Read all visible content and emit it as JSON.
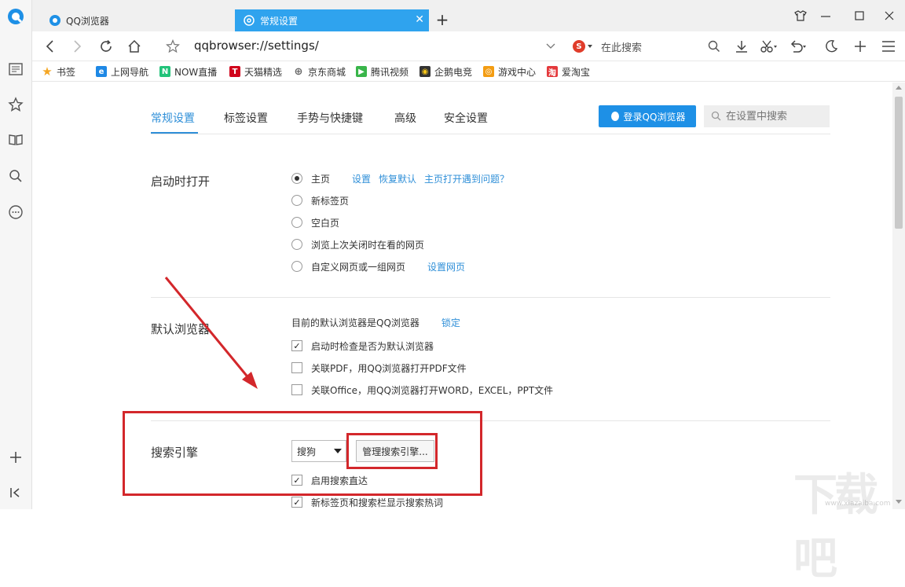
{
  "tabs": [
    {
      "label": "QQ浏览器",
      "active": false
    },
    {
      "label": "常规设置",
      "active": true
    }
  ],
  "address": {
    "url": "qqbrowser://settings/",
    "search_placeholder": "在此搜索",
    "search_engine_badge": "S"
  },
  "bookmarks": [
    {
      "label": "书签",
      "icon": "star-icon"
    },
    {
      "label": "上网导航",
      "icon": "ie-icon"
    },
    {
      "label": "NOW直播",
      "icon": "now-icon"
    },
    {
      "label": "天猫精选",
      "icon": "tmall-icon"
    },
    {
      "label": "京东商城",
      "icon": "globe-icon"
    },
    {
      "label": "腾讯视频",
      "icon": "tencent-video-icon"
    },
    {
      "label": "企鹅电竞",
      "icon": "penguin-icon"
    },
    {
      "label": "游戏中心",
      "icon": "game-icon"
    },
    {
      "label": "爱淘宝",
      "icon": "taobao-icon"
    }
  ],
  "settings_tabs": [
    "常规设置",
    "标签设置",
    "手势与快捷键",
    "高级",
    "安全设置"
  ],
  "login_button": "登录QQ浏览器",
  "settings_search_placeholder": "在设置中搜索",
  "startup": {
    "title": "启动时打开",
    "options": [
      "主页",
      "新标签页",
      "空白页",
      "浏览上次关闭时在看的网页",
      "自定义网页或一组网页"
    ],
    "selected": 0,
    "links_home": [
      "设置",
      "恢复默认",
      "主页打开遇到问题？"
    ],
    "link_custom": "设置网页"
  },
  "default_browser": {
    "title": "默认浏览器",
    "status": "目前的默认浏览器是QQ浏览器",
    "lock_link": "锁定",
    "checks": [
      {
        "label": "启动时检查是否为默认浏览器",
        "checked": true
      },
      {
        "label": "关联PDF，用QQ浏览器打开PDF文件",
        "checked": false
      },
      {
        "label": "关联Office，用QQ浏览器打开WORD，EXCEL，PPT文件",
        "checked": false
      }
    ]
  },
  "search_engine": {
    "title": "搜索引擎",
    "selected": "搜狗",
    "manage_button": "管理搜索引擎...",
    "checks": [
      {
        "label": "启用搜索直达",
        "checked": true
      },
      {
        "label": "新标签页和搜索栏显示搜索热词",
        "checked": true
      }
    ]
  },
  "colors": {
    "accent": "#2f8fd8",
    "active_tab": "#2fa3ee",
    "annotation_red": "#d3272b"
  },
  "watermark": {
    "text": "下载吧",
    "url": "www.xiazaiba.com"
  }
}
